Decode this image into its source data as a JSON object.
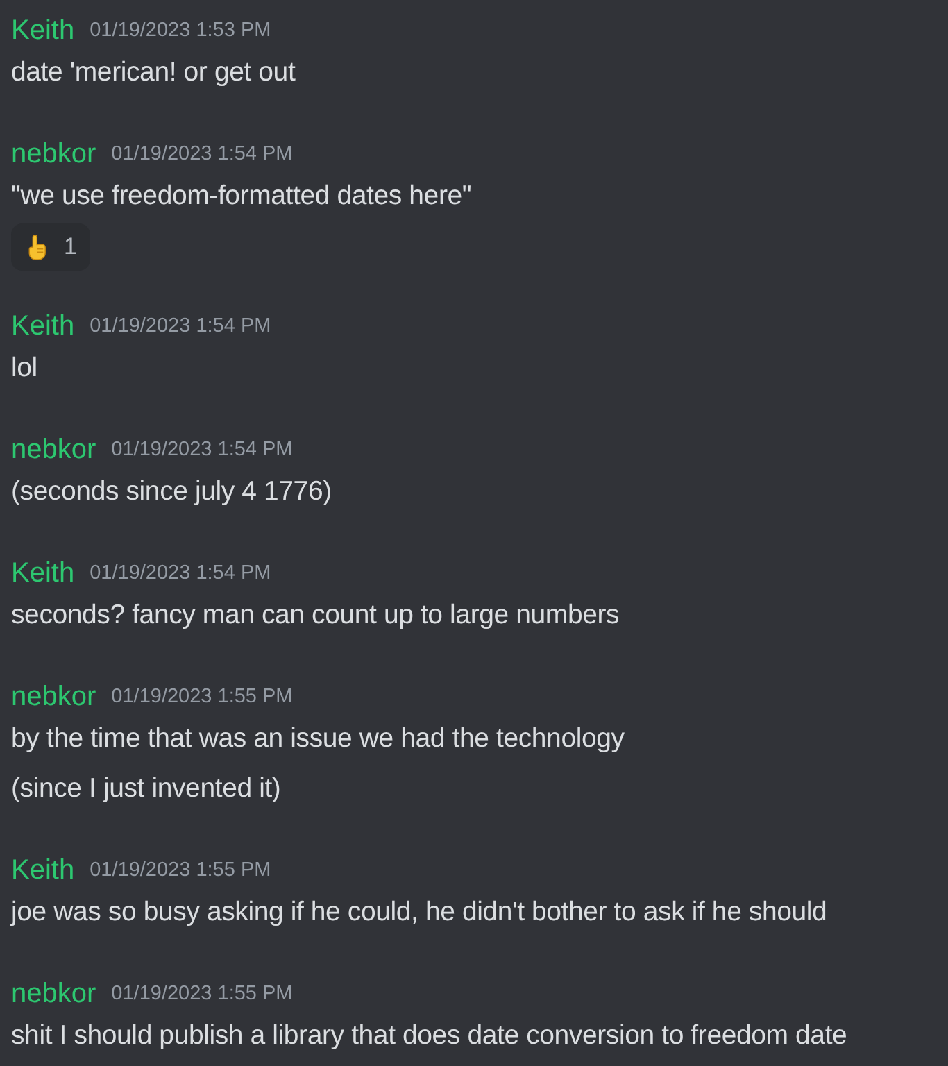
{
  "messages": [
    {
      "author": "Keith",
      "timestamp": "01/19/2023 1:53 PM",
      "lines": [
        "date 'merican! or get out"
      ]
    },
    {
      "author": "nebkor",
      "timestamp": "01/19/2023 1:54 PM",
      "lines": [
        "\"we use freedom-formatted dates here\""
      ],
      "reactions": [
        {
          "count": "1"
        }
      ]
    },
    {
      "author": "Keith",
      "timestamp": "01/19/2023 1:54 PM",
      "lines": [
        "lol"
      ]
    },
    {
      "author": "nebkor",
      "timestamp": "01/19/2023 1:54 PM",
      "lines": [
        "(seconds since july 4 1776)"
      ]
    },
    {
      "author": "Keith",
      "timestamp": "01/19/2023 1:54 PM",
      "lines": [
        "seconds? fancy man can count up to large numbers"
      ]
    },
    {
      "author": "nebkor",
      "timestamp": "01/19/2023 1:55 PM",
      "lines": [
        "by the time that was an issue we had the technology",
        "(since I just invented it)"
      ]
    },
    {
      "author": "Keith",
      "timestamp": "01/19/2023 1:55 PM",
      "lines": [
        "joe was so busy asking if he could, he didn't bother to ask if he should"
      ]
    },
    {
      "author": "nebkor",
      "timestamp": "01/19/2023 1:55 PM",
      "lines": [
        "shit I should publish a library that does date conversion to freedom date"
      ]
    }
  ]
}
